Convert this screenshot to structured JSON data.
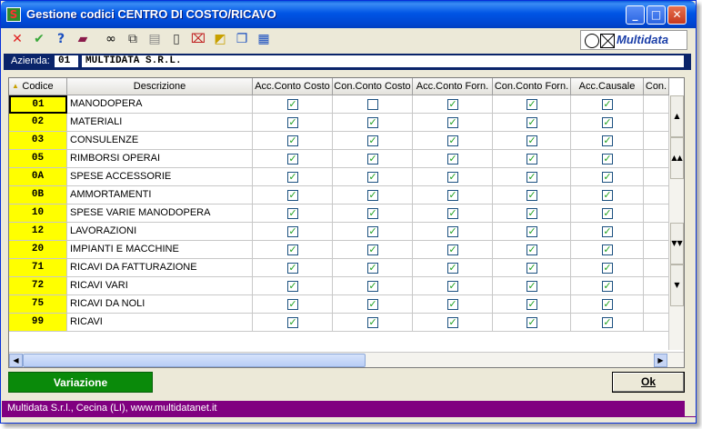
{
  "window": {
    "title": "Gestione codici CENTRO DI COSTO/RICAVO",
    "min_icon": "minimize-icon",
    "max_icon": "maximize-icon",
    "close_icon": "close-icon"
  },
  "toolbar": {
    "icons": [
      "cancel-icon",
      "confirm-icon",
      "help-icon",
      "book-icon",
      "binoculars-icon",
      "copy-icon",
      "paste-icon",
      "new-page-icon",
      "delete-row-icon",
      "edit-icon",
      "window-icon",
      "properties-icon"
    ],
    "logo_text": "Multidata"
  },
  "azienda": {
    "label": "Azienda:",
    "code": "01",
    "name": "MULTIDATA S.R.L."
  },
  "table": {
    "columns": [
      "Codice",
      "Descrizione",
      "Acc.Conto Costo",
      "Con.Conto Costo",
      "Acc.Conto Forn.",
      "Con.Conto Forn.",
      "Acc.Causale",
      "Con."
    ],
    "rows": [
      {
        "code": "01",
        "desc": "MANODOPERA",
        "checks": [
          true,
          false,
          true,
          true,
          true
        ]
      },
      {
        "code": "02",
        "desc": "MATERIALI",
        "checks": [
          true,
          true,
          true,
          true,
          true
        ]
      },
      {
        "code": "03",
        "desc": "CONSULENZE",
        "checks": [
          true,
          true,
          true,
          true,
          true
        ]
      },
      {
        "code": "05",
        "desc": "RIMBORSI OPERAI",
        "checks": [
          true,
          true,
          true,
          true,
          true
        ]
      },
      {
        "code": "0A",
        "desc": "SPESE ACCESSORIE",
        "checks": [
          true,
          true,
          true,
          true,
          true
        ]
      },
      {
        "code": "0B",
        "desc": "AMMORTAMENTI",
        "checks": [
          true,
          true,
          true,
          true,
          true
        ]
      },
      {
        "code": "10",
        "desc": "SPESE VARIE MANODOPERA",
        "checks": [
          true,
          true,
          true,
          true,
          true
        ]
      },
      {
        "code": "12",
        "desc": "LAVORAZIONI",
        "checks": [
          true,
          true,
          true,
          true,
          true
        ]
      },
      {
        "code": "20",
        "desc": "IMPIANTI E MACCHINE",
        "checks": [
          true,
          true,
          true,
          true,
          true
        ]
      },
      {
        "code": "71",
        "desc": "RICAVI DA FATTURAZIONE",
        "checks": [
          true,
          true,
          true,
          true,
          true
        ]
      },
      {
        "code": "72",
        "desc": "RICAVI VARI",
        "checks": [
          true,
          true,
          true,
          true,
          true
        ]
      },
      {
        "code": "75",
        "desc": "RICAVI DA NOLI",
        "checks": [
          true,
          true,
          true,
          true,
          true
        ]
      },
      {
        "code": "99",
        "desc": "RICAVI",
        "checks": [
          true,
          true,
          true,
          true,
          true
        ]
      }
    ]
  },
  "buttons": {
    "variazione": "Variazione",
    "ok": "Ok"
  },
  "status": "Multidata S.r.l., Cecina (LI), www.multidatanet.it"
}
